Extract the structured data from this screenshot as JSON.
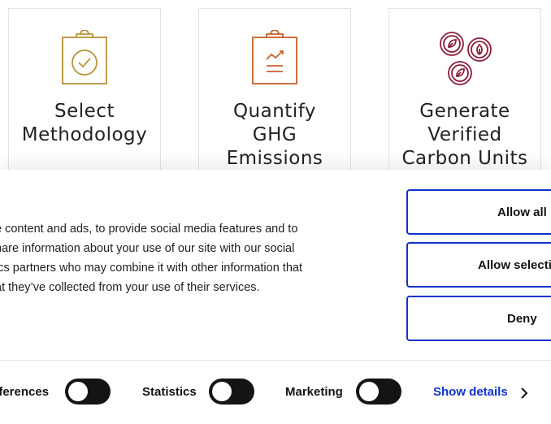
{
  "cards": [
    {
      "title_lines": [
        "Select",
        "Methodology"
      ],
      "icon": "clipboard-check-icon",
      "icon_color": "#b8923a"
    },
    {
      "title_lines": [
        "Quantify",
        "GHG",
        "Emissions"
      ],
      "icon": "clipboard-chart-icon",
      "icon_color": "#c8612b"
    },
    {
      "title_lines": [
        "Generate",
        "Verified",
        "Carbon Units"
      ],
      "icon": "carbon-coins-icon",
      "icon_color": "#8e1d3a"
    }
  ],
  "cookie_banner": {
    "body_lines": [
      "e content and ads, to provide social media features and to",
      "hare information about your use of our site with our social",
      "ics partners who may combine it with other information that",
      "at they’ve collected from your use of their services."
    ],
    "buttons": {
      "allow_all": "Allow all",
      "allow_selection": "Allow selecti",
      "deny": "Deny"
    },
    "toggles": [
      {
        "label": "eferences",
        "enabled": false
      },
      {
        "label": "Statistics",
        "enabled": false
      },
      {
        "label": "Marketing",
        "enabled": false
      }
    ],
    "show_details": "Show details"
  },
  "colors": {
    "accent_blue": "#1032cf",
    "toggle_off": "#141414",
    "text": "#141414"
  }
}
